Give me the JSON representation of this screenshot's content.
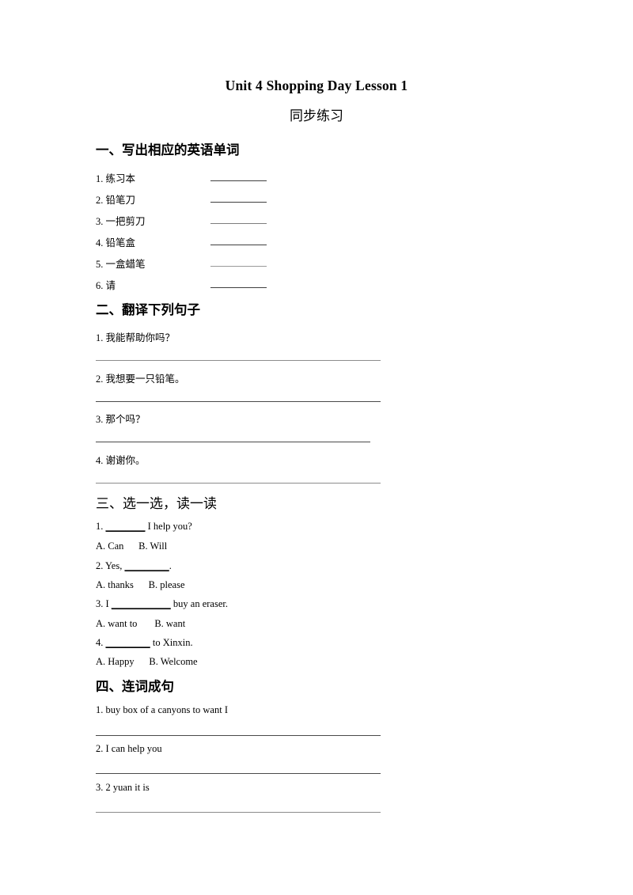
{
  "document": {
    "title": "Unit 4 Shopping Day Lesson 1",
    "subtitle": "同步练习"
  },
  "sections": [
    {
      "heading": "一、写出相应的英语单词",
      "type": "word-list",
      "items": [
        {
          "number": "1.",
          "text": "练习本"
        },
        {
          "number": "2.",
          "text": "铅笔刀"
        },
        {
          "number": "3.",
          "text": "一把剪刀"
        },
        {
          "number": "4.",
          "text": "铅笔盒"
        },
        {
          "number": "5.",
          "text": "一盒蜡笔"
        },
        {
          "number": "6.",
          "text": "请"
        }
      ]
    },
    {
      "heading": "二、翻译下列句子",
      "type": "translation",
      "items": [
        {
          "number": "1.",
          "text": "我能帮助你吗？"
        },
        {
          "number": "2.",
          "text": "我想要一只铅笔。"
        },
        {
          "number": "3.",
          "text": "那个吗？"
        },
        {
          "number": "4.",
          "text": "谢谢你。"
        }
      ]
    },
    {
      "heading": "三、选一选，读一读",
      "type": "multiple-choice",
      "questions": [
        {
          "number": "1.",
          "before": "",
          "blank": "________",
          "after": " I help you?",
          "option_a": "A. Can",
          "option_b": "B. Will"
        },
        {
          "number": "2.",
          "before": " Yes,",
          "blank": "_________",
          "after": ".",
          "option_a": "A. thanks",
          "option_b": "B. please"
        },
        {
          "number": "3.",
          "before": " I",
          "blank": "____________",
          "after": " buy an eraser.",
          "option_a": "A. want to",
          "option_b": "B. want"
        },
        {
          "number": "4.",
          "before": "",
          "blank": "_________",
          "after": " to Xinxin.",
          "option_a": "A. Happy",
          "option_b": "B. Welcome"
        }
      ]
    },
    {
      "heading": "四、连词成句",
      "type": "word-order",
      "items": [
        {
          "number": "1.",
          "text": "buy box of a canyons to want I"
        },
        {
          "number": "2.",
          "text": "I can help you"
        },
        {
          "number": "3.",
          "text": "2 yuan it is"
        }
      ]
    }
  ]
}
